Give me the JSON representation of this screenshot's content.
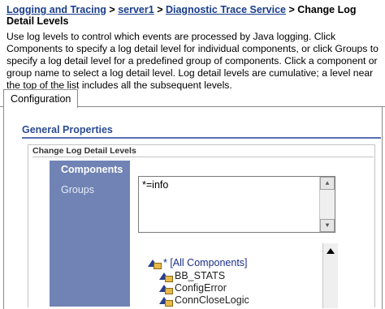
{
  "breadcrumb": {
    "items": [
      "Logging and Tracing",
      "server1",
      "Diagnostic Trace Service"
    ],
    "separator": ">",
    "current": "Change Log Detail Levels"
  },
  "description": "Use log levels to control which events are processed by Java logging. Click Components to specify a log detail level for individual components, or click Groups to specify a log detail level for a predefined group of components. Click a component or group name to select a log detail level. Log detail levels are cumulative; a level near the top of the list includes all the subsequent levels.",
  "tabs": [
    "Configuration"
  ],
  "general_properties": "General Properties",
  "section_title": "Change Log Detail Levels",
  "nav": {
    "items": [
      "Components",
      "Groups"
    ],
    "active": "Components"
  },
  "trace_spec": {
    "value": "*=info"
  },
  "tree": {
    "items": [
      "* [All Components]",
      "BB_STATS",
      "ConfigError",
      "ConnCloseLogic"
    ]
  },
  "colors": {
    "link": "#1a3d8c",
    "heading": "#2b4b96",
    "nav_bg": "#7083b4",
    "tree_icon": "#2a3e8c"
  },
  "icons": [
    "triangle-folder-icon",
    "scroll-up-arrow-icon",
    "scroll-down-arrow-icon"
  ]
}
